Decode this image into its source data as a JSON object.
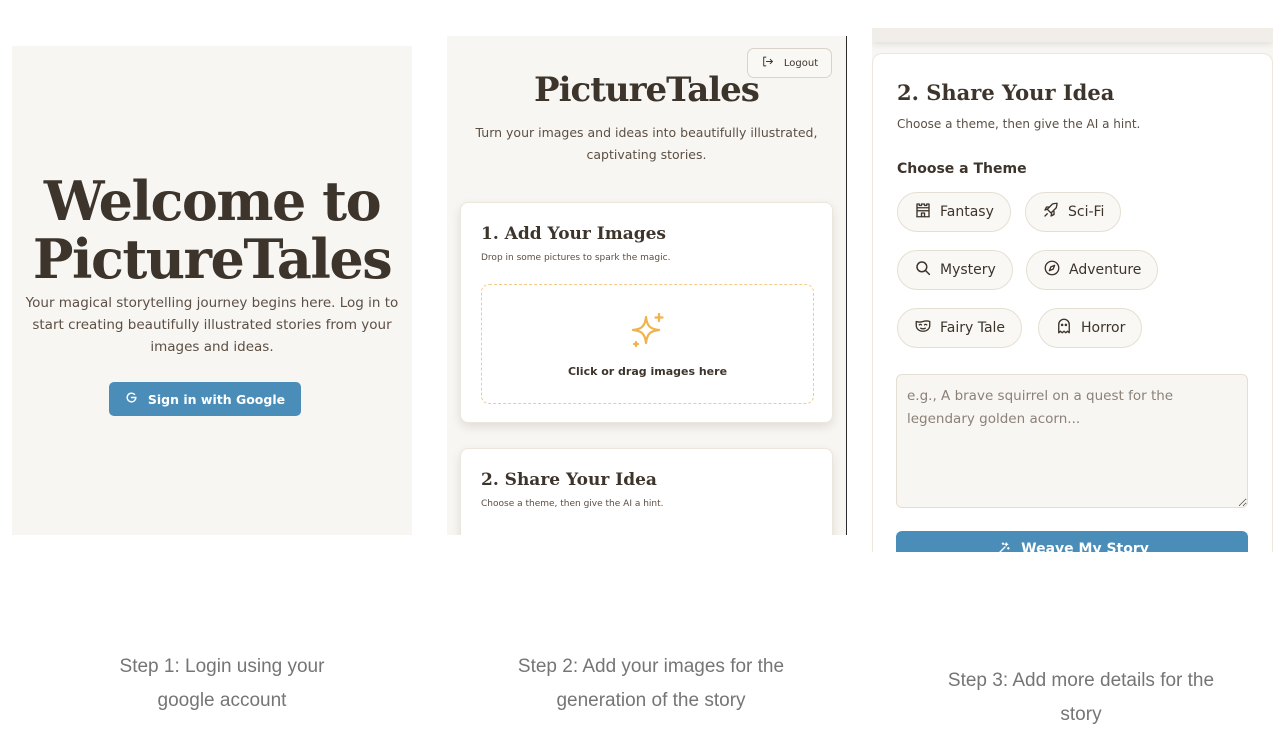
{
  "steps": [
    {
      "caption": "Step 1: Login using your google account",
      "welcome_title": "Welcome to PictureTales",
      "description": "Your magical storytelling journey begins here. Log in to start creating beautifully illustrated stories from your images and ideas.",
      "google_button": "Sign in with Google",
      "google_icon": "google-icon"
    },
    {
      "caption": "Step 2: Add your images for the generation of the story",
      "logout_label": "Logout",
      "brand": "PictureTales",
      "tagline": "Turn your images and ideas into beautifully illustrated, captivating stories.",
      "add_images": {
        "title": "1. Add Your Images",
        "subtitle": "Drop in some pictures to spark the magic.",
        "drop_label": "Click or drag images here"
      },
      "share_idea": {
        "title": "2. Share Your Idea",
        "subtitle": "Choose a theme, then give the AI a hint."
      }
    },
    {
      "caption": "Step 3: Add more details for the story",
      "title": "2. Share Your Idea",
      "subtitle": "Choose a theme, then give the AI a hint.",
      "theme_heading": "Choose a Theme",
      "themes": [
        {
          "label": "Fantasy",
          "icon": "castle-icon"
        },
        {
          "label": "Sci-Fi",
          "icon": "rocket-icon"
        },
        {
          "label": "Mystery",
          "icon": "search-icon"
        },
        {
          "label": "Adventure",
          "icon": "compass-icon"
        },
        {
          "label": "Fairy Tale",
          "icon": "mask-icon"
        },
        {
          "label": "Horror",
          "icon": "ghost-icon"
        }
      ],
      "prompt_placeholder": "e.g., A brave squirrel on a quest for the legendary golden acorn...",
      "weave_button": "Weave My Story"
    }
  ],
  "colors": {
    "primary": "#4a8db9",
    "panel_bg": "#f8f6f2",
    "heading": "#3d342c",
    "accent_gold": "#f0b24a",
    "dashed_border": "#f5c98c",
    "caption": "#757575"
  }
}
